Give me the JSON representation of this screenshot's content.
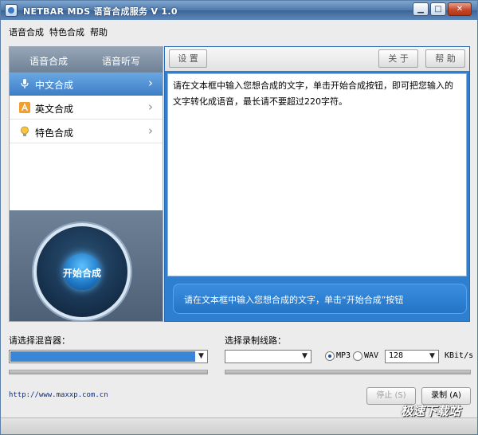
{
  "window": {
    "title": "NETBAR MDS 语音合成服务 V 1.0",
    "controls": {
      "minimize": "▁",
      "maximize": "□",
      "close": "✕"
    }
  },
  "menu": [
    "语音合成",
    "特色合成",
    "帮助"
  ],
  "left_panel": {
    "tabs": [
      "语音合成",
      "语音听写"
    ],
    "items": [
      {
        "label": "中文合成",
        "icon": "microphone-icon",
        "active": true
      },
      {
        "label": "英文合成",
        "icon": "letter-a-icon",
        "active": false
      },
      {
        "label": "特色合成",
        "icon": "lightbulb-icon",
        "active": false
      }
    ],
    "chevron": "›",
    "start_button": "开始合成"
  },
  "toolbar": {
    "settings": "设 置",
    "about": "关 于",
    "help": "帮 助"
  },
  "editor": {
    "text": "请在文本框中输入您想合成的文字，单击开始合成按钮，即可把您输入的文字转化成语音，最长请不要超过220字符。"
  },
  "hint": "请在文本框中输入您想合成的文字，单击“开始合成”按钮",
  "mixer": {
    "label": "请选择混音器：",
    "value": ""
  },
  "record_line": {
    "label": "选择录制线路：",
    "value": ""
  },
  "format": {
    "options": [
      "MP3",
      "WAV"
    ],
    "selected": "MP3"
  },
  "bitrate": {
    "value": "128",
    "unit": "KBit/s"
  },
  "url": "http://www.maxxp.com.cn",
  "buttons": {
    "stop": "停止 (S)",
    "record": "录制 (A)"
  },
  "watermark": "极速下载站",
  "colors": {
    "accent": "#2f7fd1",
    "title_bar": "#4f79ab",
    "active_item": "#3f7fc7"
  }
}
